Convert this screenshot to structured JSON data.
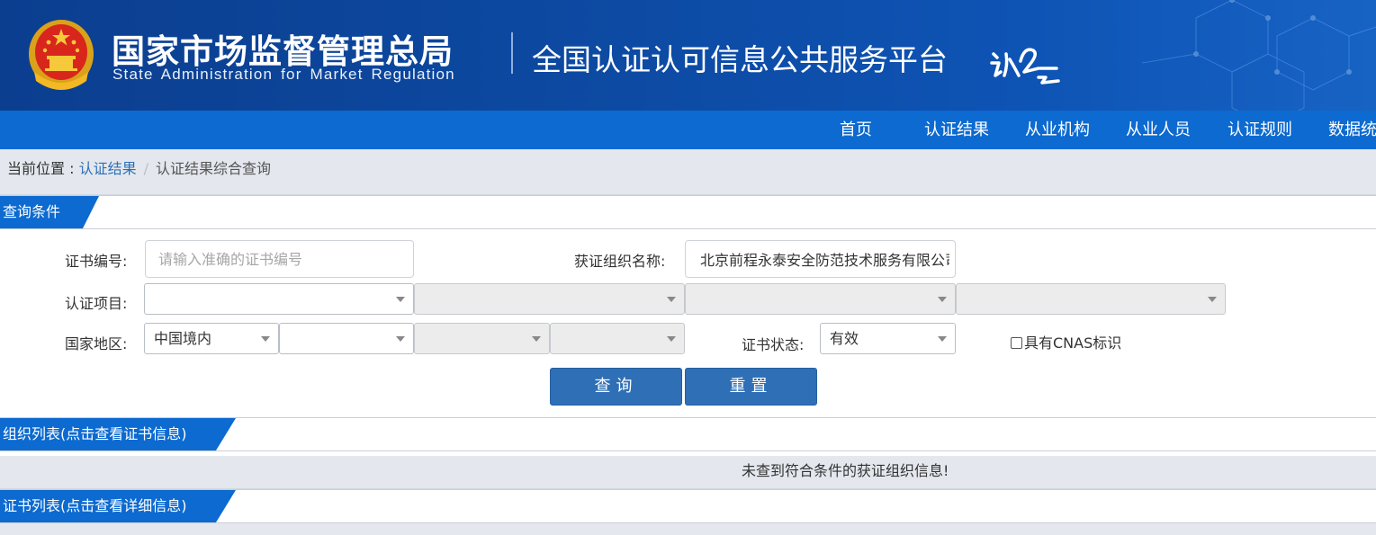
{
  "header": {
    "agency_name_cn": "国家市场监督管理总局",
    "agency_name_en": "State Administration  for  Market Regulation",
    "platform_title": "全国认证认可信息公共服务平台"
  },
  "nav": {
    "items": [
      {
        "label": "首页"
      },
      {
        "label": "认证结果"
      },
      {
        "label": "从业机构"
      },
      {
        "label": "从业人员"
      },
      {
        "label": "认证规则"
      },
      {
        "label": "数据统计"
      }
    ]
  },
  "breadcrumb": {
    "prefix": "当前位置 : ",
    "link": "认证结果",
    "separator": "/",
    "current": "认证结果综合查询"
  },
  "query_section": {
    "title": "查询条件",
    "cert_no_label": "证书编号:",
    "cert_no_placeholder": "请输入准确的证书编号",
    "cert_no_value": "",
    "org_name_label": "获证组织名称:",
    "org_name_value": "北京前程永泰安全防范技术服务有限公司",
    "project_label": "认证项目:",
    "project_selects": [
      "",
      "",
      "",
      ""
    ],
    "region_label": "国家地区:",
    "region_selects": [
      "中国境内",
      "",
      "",
      ""
    ],
    "status_label": "证书状态:",
    "status_value": "有效",
    "cnas_label": "具有CNAS标识",
    "cnas_checked": false,
    "search_button": "查询",
    "reset_button": "重置"
  },
  "org_section": {
    "title": "组织列表(点击查看证书信息)",
    "empty_message": "未查到符合条件的获证组织信息!"
  },
  "cert_section": {
    "title": "证书列表(点击查看详细信息)"
  },
  "colors": {
    "banner": "#0d4aa3",
    "nav": "#0c6ad0",
    "button": "#2f6fb5",
    "link": "#2f6fb6"
  }
}
